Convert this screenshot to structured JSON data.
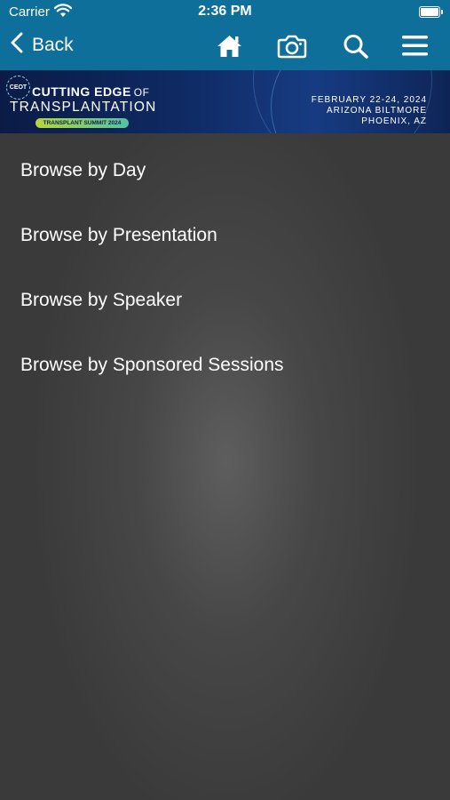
{
  "status_bar": {
    "carrier": "Carrier",
    "time": "2:36 PM"
  },
  "nav": {
    "back_label": "Back",
    "icons": [
      "home-icon",
      "camera-icon",
      "search-icon",
      "menu-icon"
    ]
  },
  "banner": {
    "badge": "CEOT",
    "title_line1": "CUTTING EDGE",
    "title_of": "OF",
    "title_line2": "TRANSPLANTATION",
    "subtitle": "TRANSPLANT SUMMIT 2024",
    "dates": "FEBRUARY 22-24, 2024",
    "venue": "ARIZONA BILTMORE",
    "city": "PHOENIX, AZ"
  },
  "menu": {
    "items": [
      {
        "label": "Browse by Day"
      },
      {
        "label": "Browse by Presentation"
      },
      {
        "label": "Browse by Speaker"
      },
      {
        "label": "Browse by Sponsored Sessions"
      }
    ]
  },
  "colors": {
    "header": "#0e6f9b",
    "background": "#474747",
    "banner": "#0f2a63"
  }
}
